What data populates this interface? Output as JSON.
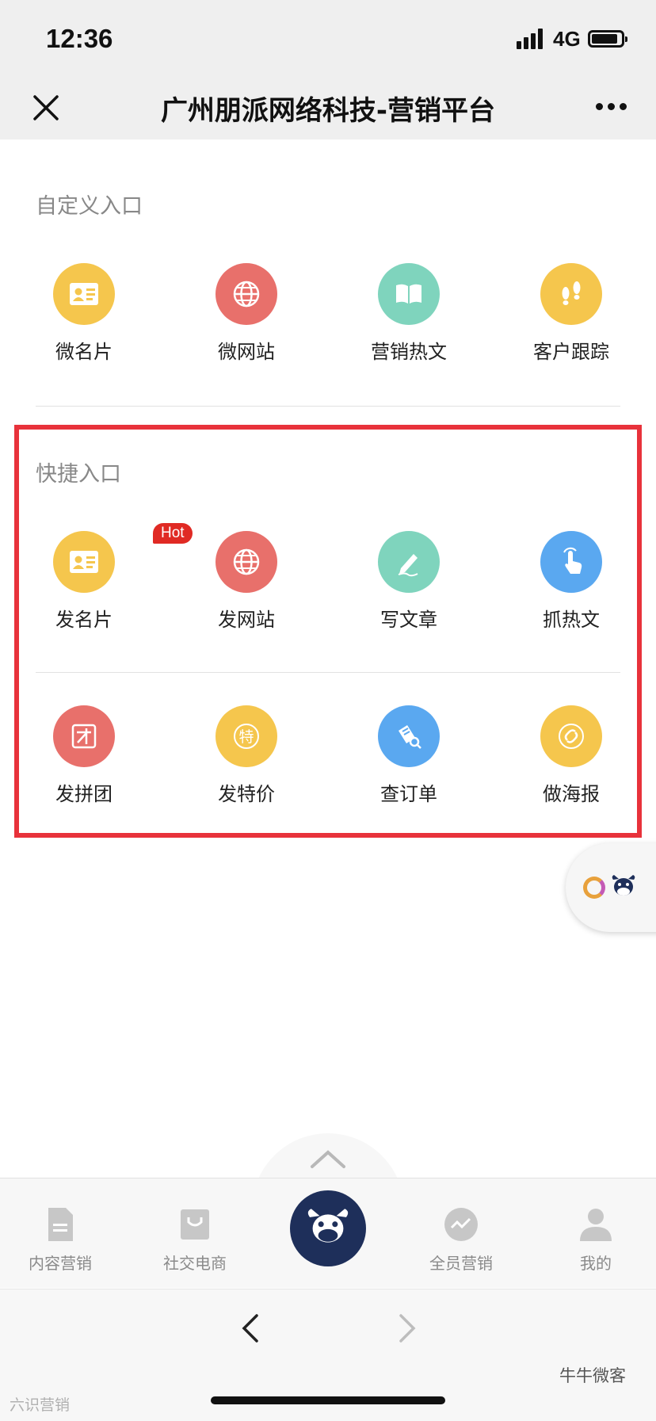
{
  "status_bar": {
    "time": "12:36",
    "network": "4G"
  },
  "nav": {
    "title": "广州朋派网络科技-营销平台"
  },
  "custom_section": {
    "title": "自定义入口",
    "items": [
      {
        "label": "微名片",
        "icon": "id-card-icon",
        "color": "#f5c64d"
      },
      {
        "label": "微网站",
        "icon": "globe-icon",
        "color": "#e8706b"
      },
      {
        "label": "营销热文",
        "icon": "book-icon",
        "color": "#7fd4bd"
      },
      {
        "label": "客户跟踪",
        "icon": "footprints-icon",
        "color": "#f5c64d"
      }
    ]
  },
  "quick_section": {
    "title": "快捷入口",
    "hot_badge": "Hot",
    "row1": [
      {
        "label": "发名片",
        "icon": "id-card-icon",
        "color": "#f5c64d"
      },
      {
        "label": "发网站",
        "icon": "globe-icon",
        "color": "#e8706b"
      },
      {
        "label": "写文章",
        "icon": "pen-icon",
        "color": "#7fd4bd"
      },
      {
        "label": "抓热文",
        "icon": "hand-tap-icon",
        "color": "#5aa8f0"
      }
    ],
    "row2": [
      {
        "label": "发拼团",
        "icon": "group-buy-icon",
        "color": "#e8706b"
      },
      {
        "label": "发特价",
        "icon": "special-price-icon",
        "color": "#f5c64d",
        "glyph": "特"
      },
      {
        "label": "查订单",
        "icon": "order-search-icon",
        "color": "#5aa8f0"
      },
      {
        "label": "做海报",
        "icon": "link-icon",
        "color": "#f5c64d"
      }
    ]
  },
  "tabbar": {
    "items": [
      {
        "label": "内容营销",
        "icon": "document-icon"
      },
      {
        "label": "社交电商",
        "icon": "shopping-bag-icon"
      },
      {
        "label": "全员营销",
        "icon": "trend-icon"
      },
      {
        "label": "我的",
        "icon": "user-icon"
      }
    ]
  },
  "watermark": {
    "left": "六识营销",
    "right": "牛牛微客"
  }
}
